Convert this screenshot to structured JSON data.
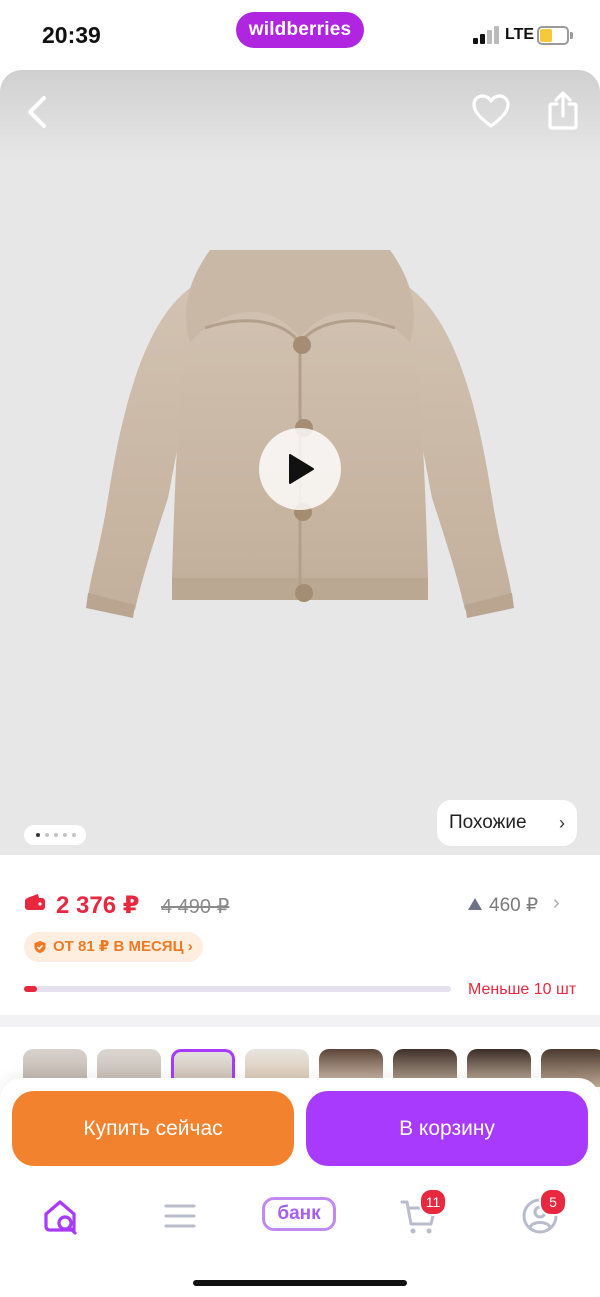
{
  "status_bar": {
    "time": "20:39",
    "network": "LTE"
  },
  "brand": {
    "logo_text": "wildberries",
    "color": "#b026e0"
  },
  "gallery": {
    "page_count": 5,
    "active_page": 1,
    "similar_label": "Похожие",
    "similar_chevron": "›"
  },
  "pricing": {
    "price": "2 376 ₽",
    "old_price": "4 490 ₽",
    "price_drop": "460 ₽",
    "price_drop_chevron": "›",
    "installment": "ОТ 81 ₽ В МЕСЯЦ ›",
    "stock_label": "Меньше 10 шт",
    "stock_level": 0.03
  },
  "variants": {
    "count": 9,
    "selected_index": 2
  },
  "actions": {
    "buy_now": "Купить сейчас",
    "add_to_cart": "В корзину"
  },
  "tabbar": {
    "bank_label": "банк",
    "cart_badge": "11",
    "profile_badge": "5"
  },
  "colors": {
    "price_red": "#e8283e",
    "accent_purple": "#a73afd",
    "accent_orange": "#f2822e"
  },
  "icons": [
    "back-arrow-icon",
    "heart-icon",
    "share-icon",
    "play-icon",
    "wallet-icon",
    "arrow-up-icon",
    "shield-icon",
    "home-search-icon",
    "menu-icon",
    "cart-icon",
    "profile-icon"
  ]
}
